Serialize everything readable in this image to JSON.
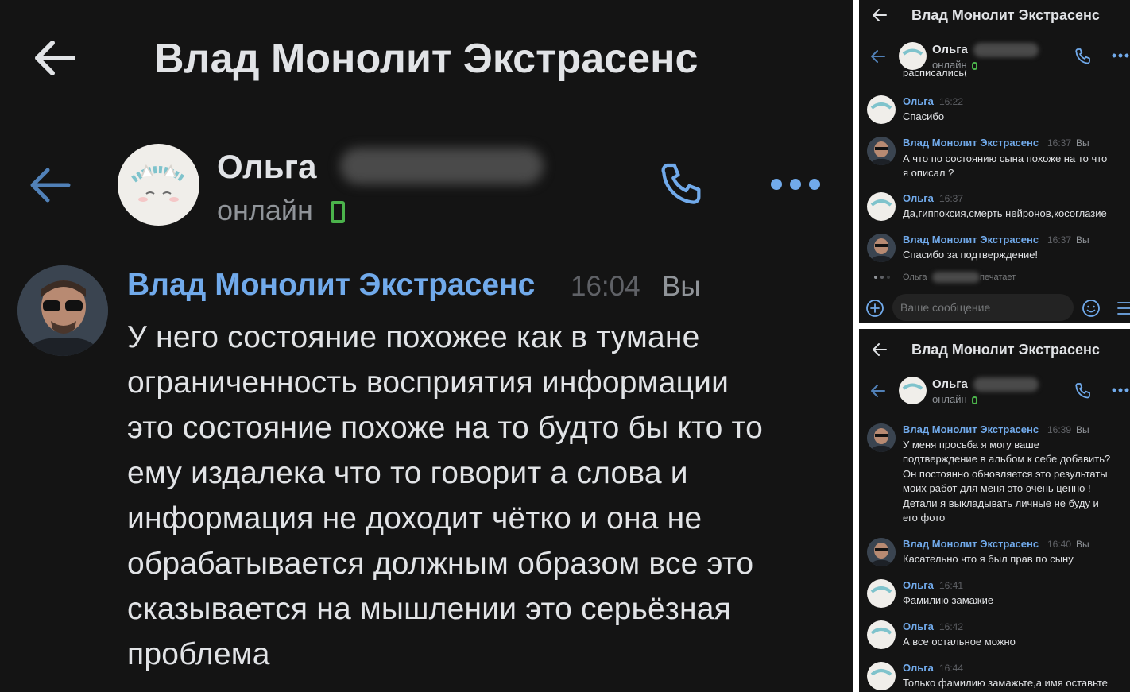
{
  "screen_title": "Влад Монолит Экстрасенс",
  "contact": {
    "name": "Ольга",
    "status": "онлайн"
  },
  "sender": "Влад Монолит Экстрасенс",
  "you_label": "Вы",
  "main": {
    "message": {
      "author": "Влад Монолит Экстрасенс",
      "time": "16:04",
      "lines": [
        "У него состояние похожее как в тумане",
        "ограниченность восприятия информации",
        "это состояние похоже на то будто бы кто то",
        "ему издалека что то говорит а слова и",
        "информация не доходит чётко и она не",
        "обрабатывается должным образом все это",
        "сказывается на мышлении это серьёзная",
        "проблема"
      ]
    }
  },
  "top_panel": {
    "cut_text": "расписались(",
    "messages": [
      {
        "author": "Ольга",
        "time": "16:22",
        "lines": [
          "Спасибо"
        ]
      },
      {
        "author": "Влад Монолит Экстрасенс",
        "time": "16:37",
        "you": true,
        "lines": [
          "А что по состоянию сына похоже на то что",
          "я описал ?"
        ]
      },
      {
        "author": "Ольга",
        "time": "16:37",
        "lines": [
          "Да,гиппоксия,смерть нейронов,косоглазие"
        ]
      },
      {
        "author": "Влад Монолит Экстрасенс",
        "time": "16:37",
        "you": true,
        "lines": [
          "Спасибо за подтверждение!"
        ]
      }
    ],
    "typing": {
      "name": "Ольга",
      "text": "печатает"
    },
    "composer": {
      "placeholder": "Ваше сообщение"
    }
  },
  "bottom_panel": {
    "messages": [
      {
        "author": "Влад Монолит Экстрасенс",
        "time": "16:39",
        "you": true,
        "lines": [
          "У меня просьба я могу ваше",
          "подтверждение в альбом к себе добавить?",
          "Он постоянно обновляется это результаты",
          "моих работ для меня это очень ценно !",
          "Детали я выкладывать личные не буду и",
          "его фото"
        ]
      },
      {
        "author": "Влад Монолит Экстрасенс",
        "time": "16:40",
        "you": true,
        "lines": [
          "Касательно что я был прав по сыну"
        ]
      },
      {
        "author": "Ольга",
        "time": "16:41",
        "lines": [
          "Фамилию замажие"
        ]
      },
      {
        "author": "Ольга",
        "time": "16:42",
        "lines": [
          "А все остальное можно"
        ]
      },
      {
        "author": "Ольга",
        "time": "16:44",
        "lines": [
          "Только фамилию замажьте,а имя оставьте"
        ]
      }
    ]
  },
  "icons": {
    "back": "arrow-left-icon",
    "call": "phone-icon",
    "more": "more-horizontal-icon",
    "attach": "plus-circle-icon",
    "emoji": "smile-icon",
    "menu": "menu-icon"
  },
  "colors": {
    "background": "#141414",
    "link": "#71aaeb",
    "text": "#e1e3e6",
    "secondary": "#909499",
    "time": "#5f6166",
    "online": "#4bb34b"
  }
}
